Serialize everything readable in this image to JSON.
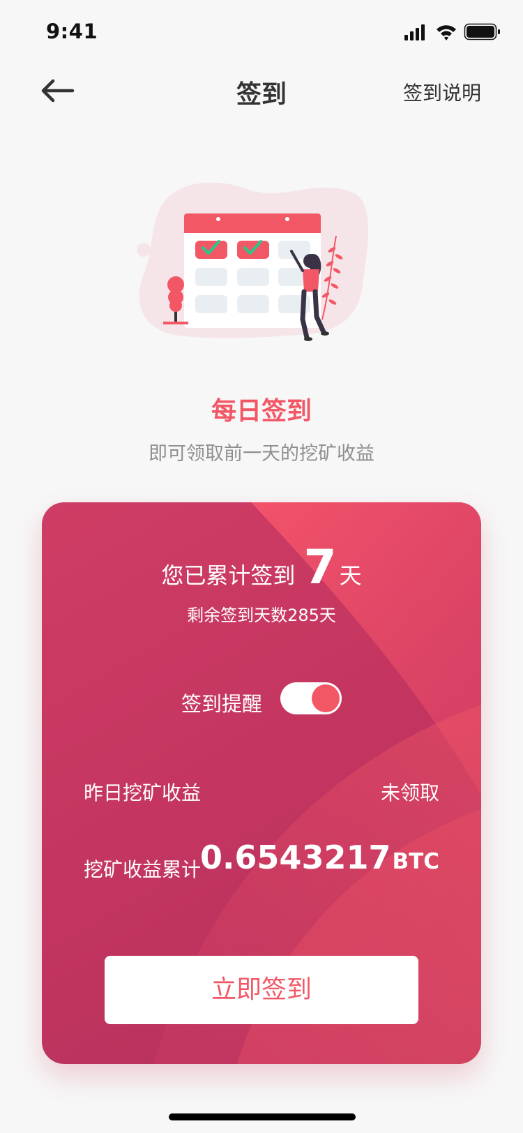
{
  "status_bar": {
    "time": "9:41"
  },
  "nav": {
    "title": "签到",
    "right_link": "签到说明"
  },
  "hero": {
    "title": "每日签到",
    "subtitle": "即可领取前一天的挖矿收益"
  },
  "card": {
    "total_prefix": "您已累计签到",
    "total_days": "7",
    "total_suffix": "天",
    "remaining": "剩余签到天数285天",
    "reminder_label": "签到提醒",
    "reminder_on": true,
    "yesterday_label": "昨日挖矿收益",
    "yesterday_value": "未领取",
    "cumulative_label": "挖矿收益累计",
    "cumulative_amount": "0.6543217",
    "cumulative_unit": "BTC",
    "button_label": "立即签到"
  },
  "colors": {
    "accent": "#f25766",
    "card_top": "#cf3d65",
    "card_bottom": "#b3305d"
  }
}
